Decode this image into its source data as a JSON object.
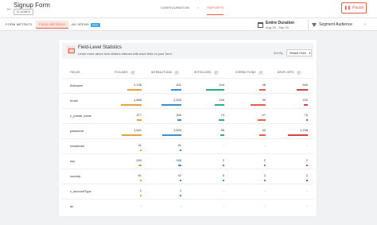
{
  "header": {
    "back_icon": "arrow-left-icon",
    "title": "Signup Form",
    "badge": "SCANNED",
    "steps": [
      "CONFIGURATION",
      "REPORTS"
    ],
    "separator": ">",
    "pause_label": "Pause",
    "pause_icon": "pause-icon"
  },
  "nav": {
    "tabs": [
      {
        "label": "FORM METRICS"
      },
      {
        "label": "FIELD METRICS"
      },
      {
        "label": "AD SPEND",
        "badge": "NEW"
      }
    ],
    "duration_title": "Entire Duration",
    "duration_range": "Aug 28 - Sep 15",
    "audience_label": "Segment Audience",
    "more_icon": "chevron-right-icon"
  },
  "card": {
    "title": "Field-Level Statistics",
    "subtitle": "Learn more about how visitors interact with each field on your form.",
    "sort_label": "Sort By",
    "sort_value": "Default Order",
    "headers": [
      "FIELDS",
      "FOCUSES",
      "INTERACTIONS",
      "REFOCUSES",
      "CORRECTIONS",
      "DROP-OFFS"
    ],
    "help": "?",
    "colors": {
      "focuses": "#e8a33d",
      "interactions": "#3b8fd6",
      "refocuses": "#2bb07f",
      "corrections": "#e8604a",
      "dropoffs": "#d94141"
    },
    "rows": [
      {
        "field": "firstname",
        "values": [
          "1,136",
          "811",
          "244",
          "38",
          "640"
        ],
        "fill": [
          0.68,
          0.5,
          0.9,
          0.3,
          0.52
        ]
      },
      {
        "field": "email",
        "values": [
          "1,665",
          "1,534",
          "126",
          "90",
          "232"
        ],
        "fill": [
          1.0,
          0.95,
          0.47,
          0.72,
          0.19
        ]
      },
      {
        "field": "c_postal_name",
        "values": [
          "377",
          "306",
          "73",
          "47",
          "75"
        ],
        "fill": [
          0.23,
          0.19,
          0.27,
          0.38,
          0.06
        ]
      },
      {
        "field": "password",
        "values": [
          "1,641",
          "1,500",
          "56",
          "40",
          "1,198"
        ],
        "fill": [
          0.98,
          0.92,
          0.21,
          0.32,
          0.98
        ]
      },
      {
        "field": "newsletter",
        "values": [
          "31",
          "31",
          "-",
          "-",
          "-"
        ],
        "fill": [
          0.02,
          0.02,
          0,
          0,
          0
        ]
      },
      {
        "field": "sso",
        "values": [
          "253",
          "245",
          "2",
          "2",
          "2"
        ],
        "fill": [
          0.15,
          0.15,
          0.01,
          0.02,
          0.01
        ]
      },
      {
        "field": "country",
        "values": [
          "61",
          "42",
          "5",
          "2",
          "2"
        ],
        "fill": [
          0.04,
          0.03,
          0.02,
          0.02,
          0.01
        ]
      },
      {
        "field": "c_accountType",
        "values": [
          "1",
          "1",
          "-",
          "-",
          "-"
        ],
        "fill": [
          0.01,
          0.01,
          0,
          0,
          0
        ]
      },
      {
        "field": "dc",
        "values": [
          "-",
          "-",
          "-",
          "-",
          "-"
        ],
        "fill": [
          0,
          0,
          0,
          0,
          0
        ]
      }
    ]
  }
}
